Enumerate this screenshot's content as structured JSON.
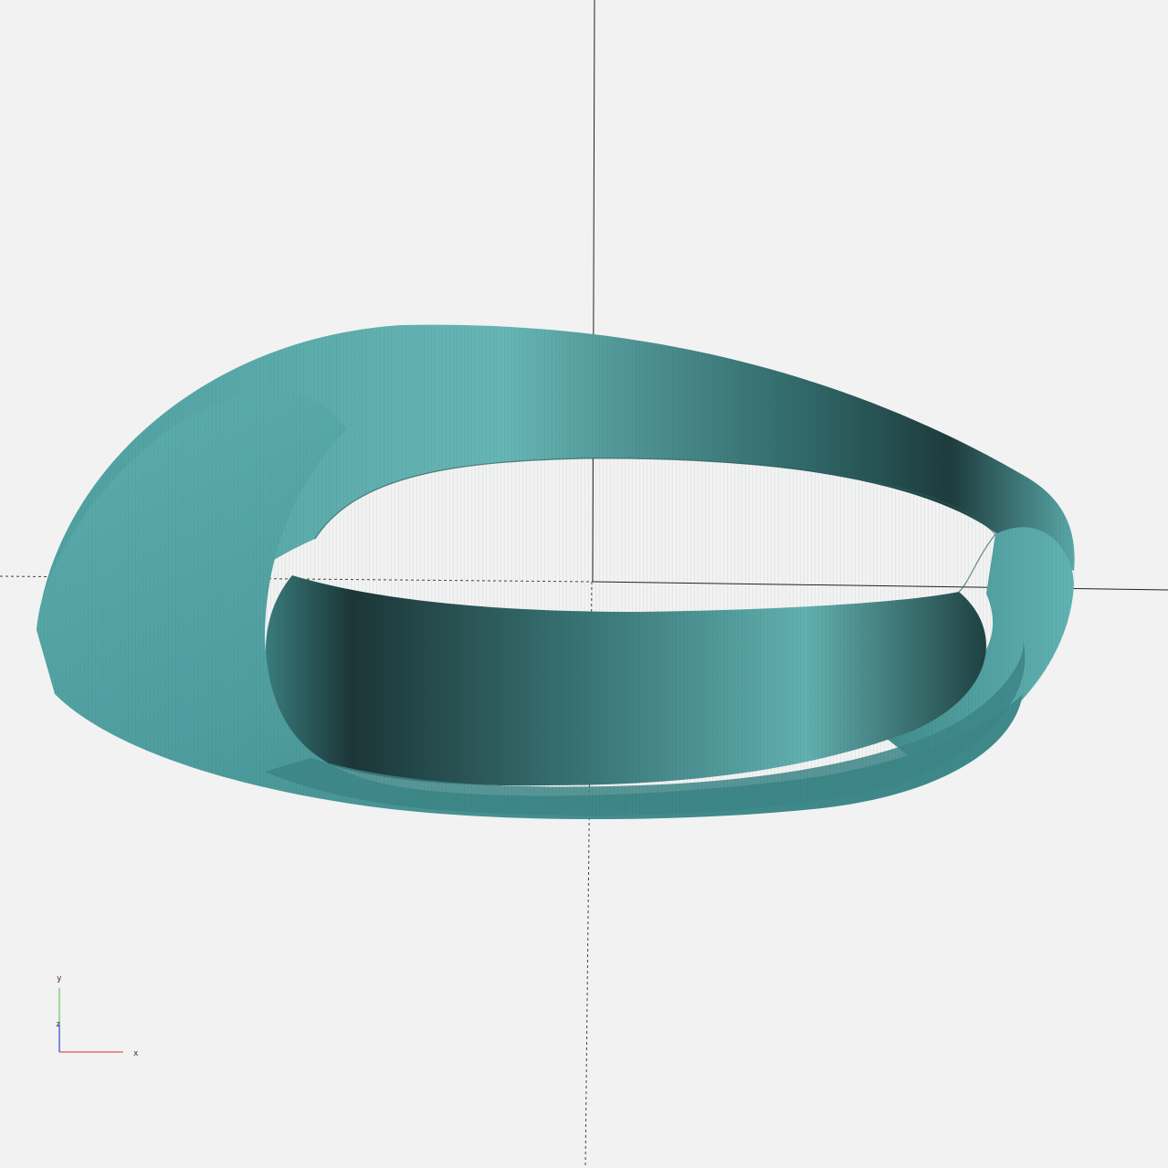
{
  "viewport": {
    "background": "#f2f2f2",
    "model_color": "#5fb0b0",
    "shape": "mobius-strip"
  },
  "axis_gizmo": {
    "x_label": "x",
    "y_label": "y",
    "z_label": "z",
    "x_color": "#e03030",
    "y_color": "#40c040",
    "z_color": "#3040e0"
  }
}
